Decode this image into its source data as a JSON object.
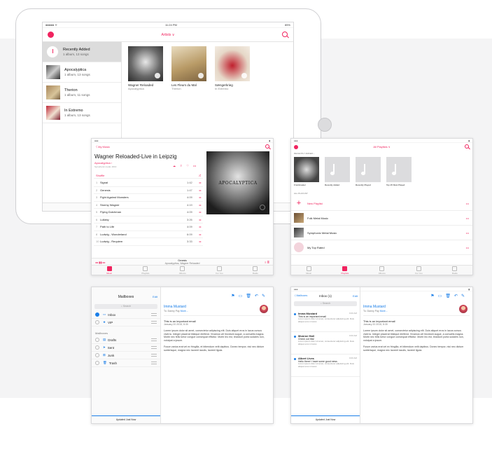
{
  "ipad": {
    "time": "11:24 PM",
    "battery": "85%",
    "nav_title": "Artists ∨",
    "artists": [
      {
        "name": "Recently Added",
        "meta": "1 album, 13 songs",
        "selected": true
      },
      {
        "name": "Apocalyptica",
        "meta": "1 album, 13 songs"
      },
      {
        "name": "Therion",
        "meta": "1 album, 11 songs"
      },
      {
        "name": "In Extremo",
        "meta": "1 album, 13 songs"
      }
    ],
    "albums": [
      {
        "title": "Wagner Reloaded",
        "artist": "Apocalyptica"
      },
      {
        "title": "Les Fleurs du Mal",
        "artist": "Therion"
      },
      {
        "title": "Sængerkrieg",
        "artist": "In Extremo"
      }
    ]
  },
  "album": {
    "back": "〈 My Music",
    "title": "Wagner Reloaded-Live in Leipzig",
    "artist": "Apocalyptica ›",
    "meta": "Symphonic metal, 2013",
    "shuffle": "Shuffle",
    "tracks": [
      [
        "1",
        "Signal",
        "1:42"
      ],
      [
        "2",
        "Genesis",
        "1:47"
      ],
      [
        "3",
        "Fight Against Monsters",
        "4:09"
      ],
      [
        "4",
        "Stormy Wagner",
        "4:19"
      ],
      [
        "5",
        "Flying Dutchman",
        "4:09"
      ],
      [
        "6",
        "Lullaby",
        "3:26"
      ],
      [
        "7",
        "Path to Life",
        "4:09"
      ],
      [
        "8",
        "Ludwig - Wonderland",
        "6:09"
      ],
      [
        "10",
        "Ludwig - Requiem",
        "3:33"
      ]
    ],
    "now_title": "Genesis",
    "now_artist": "Apocalyptica, Wagner Reloaded",
    "cover_text": "APOCALYPTICA",
    "tabs": [
      "Music",
      "Playlists",
      "Albums",
      "For You",
      "Radio"
    ]
  },
  "playlists": {
    "title": "All Playlists ∨",
    "recent_label": "RECENTLY ADDED ›",
    "recent": [
      "Frontimaster",
      "Recently Added",
      "Recently Played",
      "Top 25 Most Played"
    ],
    "all_label": "ALL PLAYLIST",
    "rows": [
      "New Playlist",
      "Folk Metal Music",
      "Symphonic Metal Music",
      "My Top Rated"
    ],
    "tabs": [
      "Music",
      "Playlists",
      "Albums",
      "For You",
      "Radio"
    ]
  },
  "mail1": {
    "title": "Mailboxes",
    "edit": "Edit",
    "search": "Search",
    "boxes": [
      "Inbox",
      "VIP"
    ],
    "section": "Mailboxes",
    "folders": [
      "Drafts",
      "Sent",
      "Junk",
      "Trash"
    ],
    "footer": "Updated Just Now",
    "from": "Imma Mustard",
    "to": "To: Danny Pay",
    "more": "More...",
    "subject": "This is an important email",
    "date": "January 20 2015, 8:30",
    "body1": "Lorem ipsum dolor sit amet, consectetur adipiscing elit. Duis aliquet eros in lacus cursus viverra. Integer placerat tristique eleifend. Vivamus vel tincidunt augue, a convallis magna. Morbi nec felis tortor congue consequat efficitur. Morbi leo est, tincidunt porta sodales non, volutpat a ipsum.",
    "body2": "Fusce varius erat vel ex fringilla, et bibendum velit dapibus. Donec tempor, nisi nec dictum scelerisque, magna nec laoreet iaculis, laoreet ligula."
  },
  "mail2": {
    "back": "〈 Mailboxes",
    "title": "Inbox (1)",
    "edit": "Edit",
    "search": "Search",
    "footer": "Updated Just Now",
    "messages": [
      {
        "from": "Imma Mustard",
        "time": "9:00 AM",
        "subject": "This is an important email",
        "preview": "Lorem ipsum dolor sit amet, consectetur adipiscing elit. Duis aliquet eros in lacus"
      },
      {
        "from": "Monroe Hall",
        "time": "9:00 AM",
        "subject": "Check out this!",
        "preview": "Lorem ipsum dolor sit amet, consectetur adipiscing elit. Duis aliquet eros in lacus"
      },
      {
        "from": "Albert Lives",
        "time": "9:00 AM",
        "subject": "Hello there! I have some good news",
        "preview": "Lorem ipsum dolor sit amet, consectetur adipiscing elit. Duis aliquet eros in lacus"
      }
    ],
    "from": "Imma Mustard",
    "to": "To: Danny Pay",
    "more": "More...",
    "subject": "This is an important email",
    "date": "January 20 2015, 8:30",
    "body1": "Lorem ipsum dolor sit amet, consectetur adipiscing elit. Duis aliquet eros in lacus cursus viverra. Integer placerat tristique eleifend. Vivamus vel tincidunt augue, a convallis magna. Morbi nec felis tortor congue consequat efficitur. Morbi leo est, tincidunt porta sodales non, volutpat a ipsum.",
    "body2": "Fusce varius erat vel ex fringilla, et bibendum velit dapibus. Donec tempor, nisi nec dictum scelerisque, magna nec laoreet iaculis, laoreet ligula."
  },
  "colors": {
    "accent": "#f0245f",
    "mail_blue": "#1a7ee8",
    "background": "#f4f4f5"
  }
}
